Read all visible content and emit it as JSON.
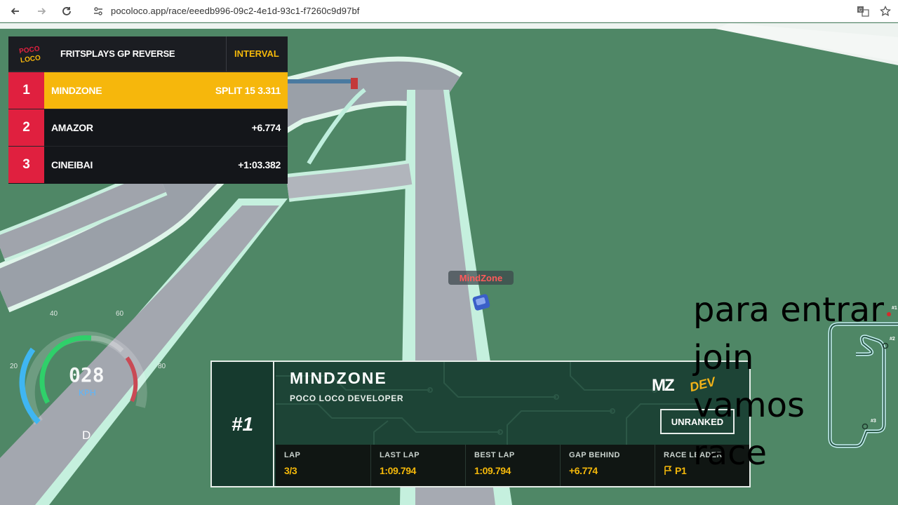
{
  "browser": {
    "url": "pocoloco.app/race/eeedb996-09c2-4e1d-93c1-f7260c9d97bf",
    "icons": [
      "back-icon",
      "forward-icon",
      "reload-icon",
      "site-info-icon",
      "translate-icon",
      "bookmark-star-icon"
    ]
  },
  "standings": {
    "logo_text": "POCO LOCO",
    "title": "FRITSPLAYS GP REVERSE",
    "interval_label": "INTERVAL",
    "rows": [
      {
        "pos": "1",
        "name": "MINDZONE",
        "value": "SPLIT 15 3.311"
      },
      {
        "pos": "2",
        "name": "AMAZOR",
        "value": "+6.774"
      },
      {
        "pos": "3",
        "name": "CINEIBAI",
        "value": "+1:03.382"
      }
    ]
  },
  "player_label": "MindZone",
  "speedometer": {
    "speed": "028",
    "unit": "KPH",
    "gear": "D",
    "ticks": [
      "20",
      "40",
      "60",
      "80"
    ]
  },
  "driver_card": {
    "rank": "#1",
    "name": "MINDZONE",
    "role": "POCO LOCO DEVELOPER",
    "initials": "MZ",
    "badge": "DEV",
    "status": "UNRANKED",
    "stats": [
      {
        "label": "LAP",
        "value": "3/3"
      },
      {
        "label": "LAST LAP",
        "value": "1:09.794"
      },
      {
        "label": "BEST LAP",
        "value": "1:09.794"
      },
      {
        "label": "GAP BEHIND",
        "value": "+6.774"
      },
      {
        "label": "RACE LEADER",
        "value": "P1"
      }
    ]
  },
  "overlay_text": "para entrar\njoin\nvamos\nrace",
  "minimap": {
    "labels": [
      "#1",
      "#2",
      "#3"
    ]
  },
  "colors": {
    "grass": "#4f8766",
    "accent_yellow": "#f6b70c",
    "position_red": "#e0203f",
    "panel_dark": "#14161a",
    "card_green": "#173a2e"
  }
}
